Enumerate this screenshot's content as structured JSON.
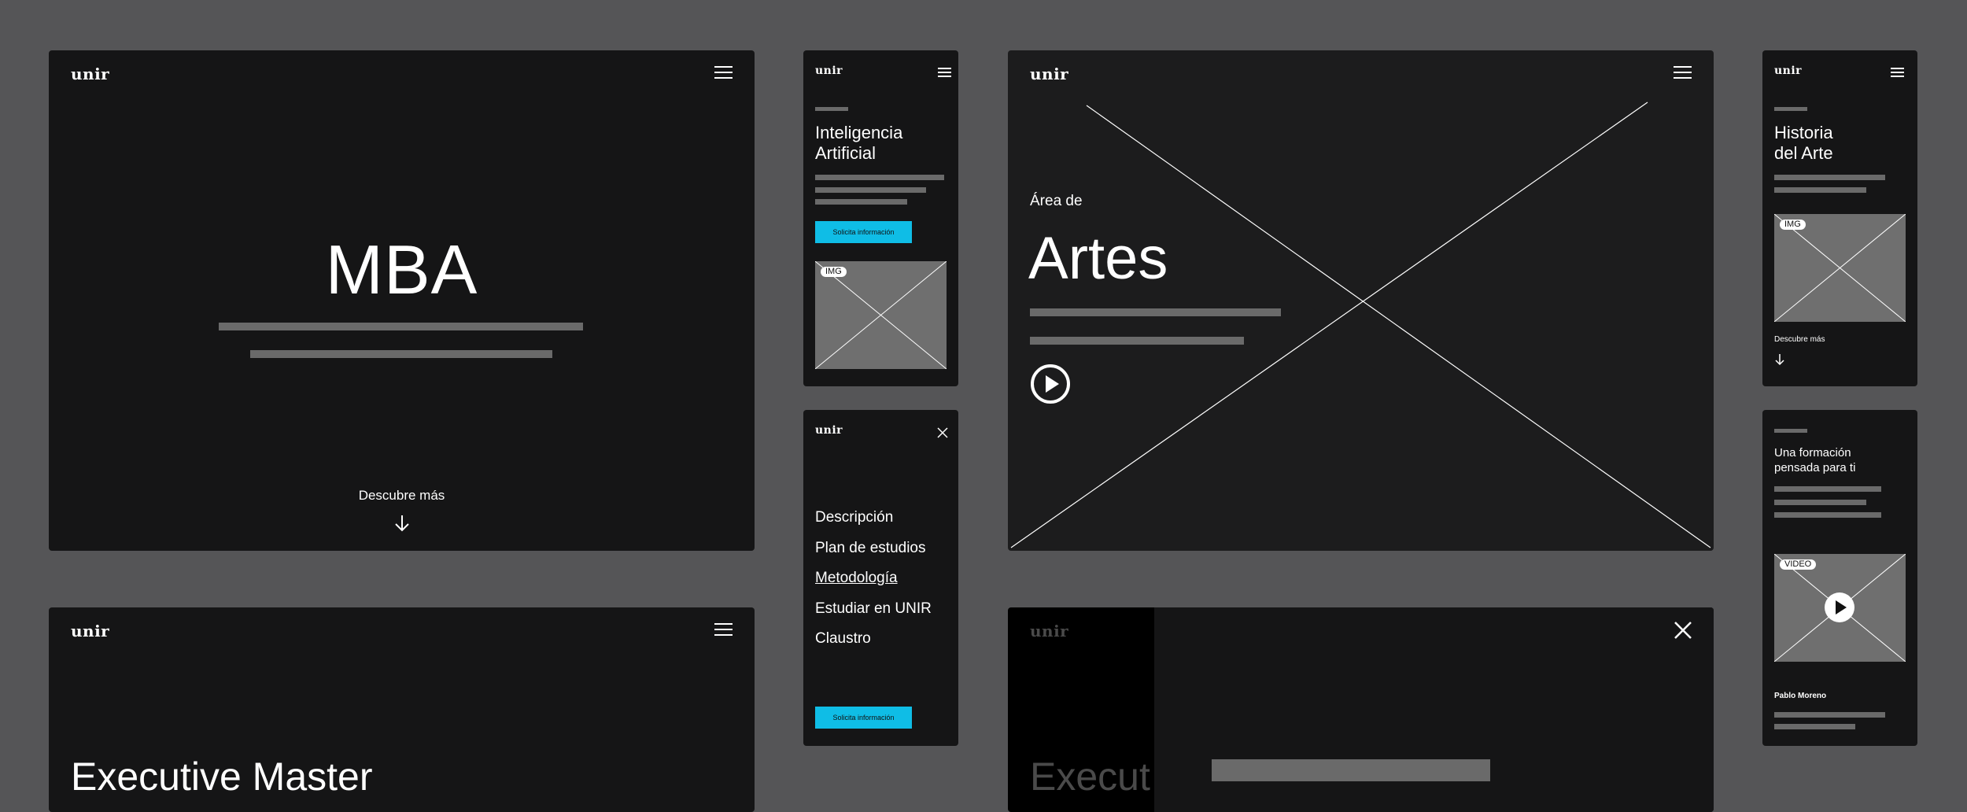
{
  "brand": "unir",
  "frames": {
    "mba": {
      "title": "MBA",
      "cta": "Descubre más"
    },
    "ia": {
      "title_line1": "Inteligencia",
      "title_line2": "Artificial",
      "button": "Solicita información",
      "img_tag": "IMG"
    },
    "menu": {
      "items": [
        "Descripción",
        "Plan de estudios",
        "Metodología",
        "Estudiar en UNIR",
        "Claustro"
      ],
      "button": "Solicita información"
    },
    "artes": {
      "kicker": "Área de",
      "title": "Artes"
    },
    "historia": {
      "title_line1": "Historia",
      "title_line2": "del Arte",
      "img_tag": "IMG",
      "cta": "Descubre más"
    },
    "formacion": {
      "title_line1": "Una formación",
      "title_line2": "pensada para ti",
      "video_tag": "VIDEO",
      "author": "Pablo Moreno"
    },
    "executive": {
      "title": "Executive Master"
    },
    "executive_overlay": {
      "title": "Execut"
    }
  }
}
